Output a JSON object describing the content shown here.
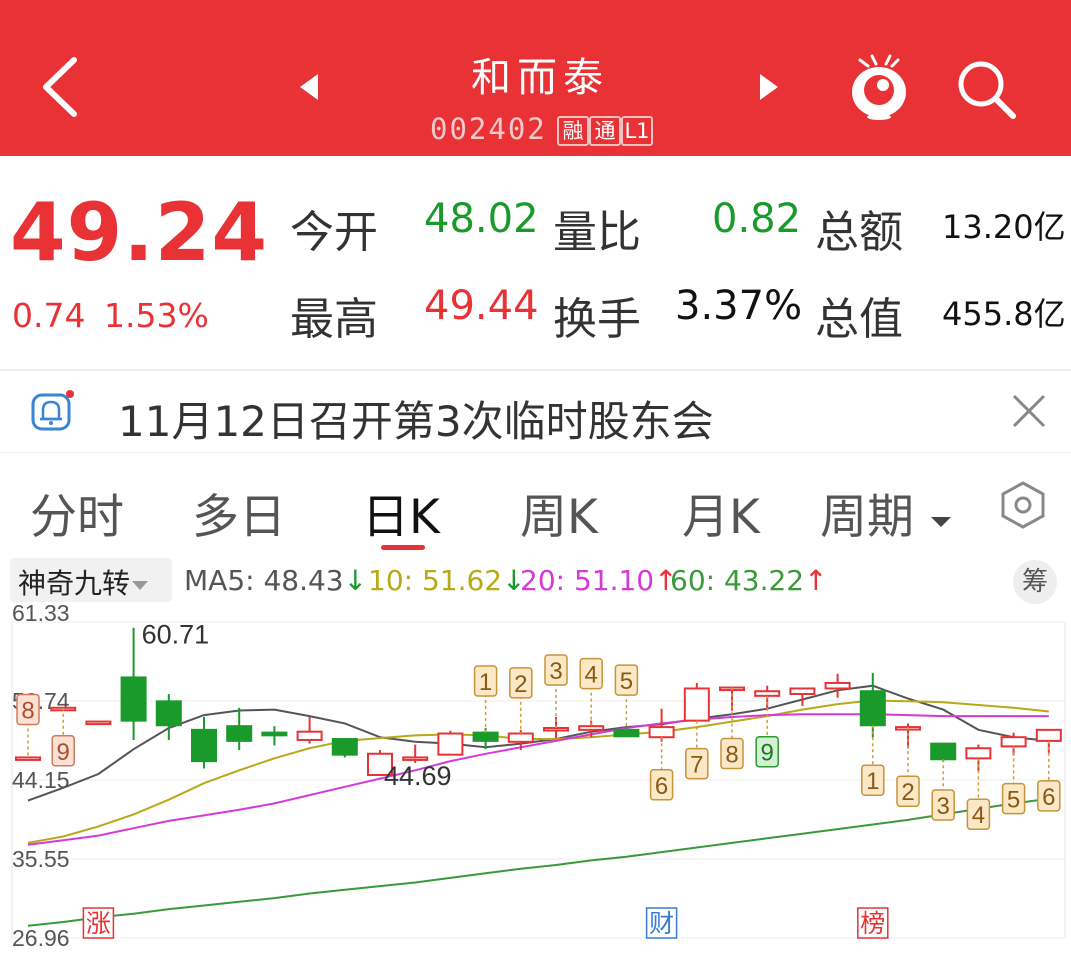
{
  "header": {
    "stock_name": "和而泰",
    "stock_code": "002402",
    "tags": [
      "融",
      "通",
      "L1"
    ],
    "bg_color": "#e83236",
    "icons": [
      "back-arrow-icon",
      "prev-triangle-icon",
      "next-triangle-icon",
      "mascot-icon",
      "search-icon"
    ]
  },
  "quote": {
    "price": "49.24",
    "change": "0.74",
    "change_pct": "1.53%",
    "open_label": "今开",
    "open": "48.02",
    "vol_ratio_label": "量比",
    "vol_ratio": "0.82",
    "amount_label": "总额",
    "amount": "13.20亿",
    "high_label": "最高",
    "high": "49.44",
    "turnover_label": "换手",
    "turnover": "3.37%",
    "mktcap_label": "总值",
    "mktcap": "455.8亿"
  },
  "notice": {
    "text": "11月12日召开第3次临时股东会",
    "icons": [
      "bell-icon",
      "close-icon"
    ]
  },
  "tabs": [
    {
      "label": "分时",
      "active": false
    },
    {
      "label": "多日",
      "active": false
    },
    {
      "label": "日K",
      "active": true
    },
    {
      "label": "周K",
      "active": false
    },
    {
      "label": "月K",
      "active": false
    },
    {
      "label": "周期",
      "active": false
    }
  ],
  "indicator": {
    "selected": "神奇九转",
    "ma5": "MA5: 48.43",
    "ma10": "10: 51.62",
    "ma20": "20: 51.10",
    "ma60": "60: 43.22",
    "chip_label": "筹",
    "colors": {
      "ma5": "#555555",
      "ma10": "#b8a91a",
      "ma20": "#d63ad6",
      "ma60": "#3a9a3a",
      "up": "#e83236",
      "down": "#1a9a2a"
    }
  },
  "chart_data": {
    "type": "candlestick",
    "y_ticks": [
      "61.33",
      "52.74",
      "44.15",
      "35.55",
      "26.96"
    ],
    "ylim": [
      26.96,
      61.33
    ],
    "max_label": "60.71",
    "min_label": "44.69",
    "candles": [
      {
        "o": 46.6,
        "h": 46.7,
        "l": 46.5,
        "c": 46.6
      },
      {
        "o": 52.0,
        "h": 52.0,
        "l": 52.0,
        "c": 52.0
      },
      {
        "o": 50.5,
        "h": 50.5,
        "l": 50.5,
        "c": 50.5
      },
      {
        "o": 55.3,
        "h": 60.71,
        "l": 48.5,
        "c": 50.6
      },
      {
        "o": 52.7,
        "h": 53.5,
        "l": 48.5,
        "c": 50.1
      },
      {
        "o": 49.6,
        "h": 51.0,
        "l": 45.4,
        "c": 46.2
      },
      {
        "o": 50.0,
        "h": 52.0,
        "l": 47.4,
        "c": 48.4
      },
      {
        "o": 49.3,
        "h": 50.0,
        "l": 47.9,
        "c": 49.0
      },
      {
        "o": 48.5,
        "h": 51.0,
        "l": 48.1,
        "c": 49.4
      },
      {
        "o": 48.6,
        "h": 48.7,
        "l": 46.6,
        "c": 46.9
      },
      {
        "o": 44.69,
        "h": 47.4,
        "l": 44.69,
        "c": 47.0
      },
      {
        "o": 46.6,
        "h": 48.0,
        "l": 46.0,
        "c": 46.6
      },
      {
        "o": 46.9,
        "h": 49.5,
        "l": 46.8,
        "c": 49.2
      },
      {
        "o": 49.3,
        "h": 49.8,
        "l": 47.5,
        "c": 48.4
      },
      {
        "o": 48.3,
        "h": 49.6,
        "l": 47.4,
        "c": 49.2
      },
      {
        "o": 49.8,
        "h": 51.0,
        "l": 48.7,
        "c": 49.8
      },
      {
        "o": 49.6,
        "h": 50.6,
        "l": 48.8,
        "c": 50.0
      },
      {
        "o": 49.6,
        "h": 49.9,
        "l": 48.8,
        "c": 48.9
      },
      {
        "o": 48.8,
        "h": 51.9,
        "l": 48.3,
        "c": 49.9
      },
      {
        "o": 50.6,
        "h": 54.7,
        "l": 50.6,
        "c": 54.1
      },
      {
        "o": 54.2,
        "h": 54.2,
        "l": 51.7,
        "c": 54.2
      },
      {
        "o": 53.3,
        "h": 54.4,
        "l": 51.9,
        "c": 53.8
      },
      {
        "o": 53.5,
        "h": 54.2,
        "l": 52.2,
        "c": 54.1
      },
      {
        "o": 54.1,
        "h": 55.7,
        "l": 53.1,
        "c": 54.7
      },
      {
        "o": 53.8,
        "h": 55.8,
        "l": 48.8,
        "c": 50.1
      },
      {
        "o": 49.9,
        "h": 50.3,
        "l": 47.6,
        "c": 49.9
      },
      {
        "o": 48.1,
        "h": 48.2,
        "l": 46.1,
        "c": 46.4
      },
      {
        "o": 46.5,
        "h": 48.0,
        "l": 45.1,
        "c": 47.6
      },
      {
        "o": 47.8,
        "h": 49.3,
        "l": 46.8,
        "c": 48.8
      },
      {
        "o": 48.4,
        "h": 49.4,
        "l": 47.1,
        "c": 49.6
      }
    ],
    "ma_series": [
      {
        "name": "MA5",
        "color": "#555555",
        "values": [
          41.9,
          43.3,
          44.8,
          47.5,
          49.8,
          51.2,
          51.7,
          51.8,
          51.1,
          50.3,
          48.8,
          48.3,
          48.1,
          47.7,
          48.1,
          48.6,
          49.4,
          49.9,
          50.2,
          50.8,
          51.3,
          51.9,
          52.9,
          53.9,
          54.4,
          53.0,
          51.8,
          49.6,
          48.8,
          48.4
        ]
      },
      {
        "name": "MA10",
        "color": "#b8a91a",
        "values": [
          37.3,
          38.0,
          39.1,
          40.4,
          42.0,
          43.8,
          45.2,
          46.5,
          47.6,
          48.4,
          48.7,
          49.0,
          49.1,
          49.0,
          48.6,
          48.6,
          48.8,
          49.1,
          49.4,
          49.9,
          50.5,
          51.1,
          51.8,
          52.4,
          52.8,
          52.7,
          52.6,
          52.3,
          52.0,
          51.6
        ]
      },
      {
        "name": "MA20",
        "color": "#d63ad6",
        "values": [
          37.1,
          37.6,
          38.1,
          38.9,
          39.7,
          40.3,
          40.9,
          41.6,
          42.5,
          43.4,
          44.3,
          45.2,
          46.2,
          47.0,
          47.7,
          48.4,
          49.1,
          49.8,
          50.3,
          50.7,
          51.0,
          51.2,
          51.3,
          51.3,
          51.3,
          51.2,
          51.1,
          51.1,
          51.1,
          51.1
        ]
      },
      {
        "name": "MA60",
        "color": "#3a9a3a",
        "values": [
          28.3,
          28.7,
          29.2,
          29.6,
          30.1,
          30.5,
          30.9,
          31.3,
          31.8,
          32.2,
          32.6,
          33.0,
          33.5,
          34.0,
          34.5,
          34.9,
          35.4,
          35.8,
          36.3,
          36.8,
          37.3,
          37.8,
          38.3,
          38.8,
          39.3,
          39.8,
          40.4,
          41.0,
          41.6,
          42.1
        ]
      }
    ],
    "nine_turn": [
      {
        "i": 0,
        "n": "8",
        "pos": "above",
        "style": "sell"
      },
      {
        "i": 1,
        "n": "9",
        "pos": "below",
        "style": "sell"
      },
      {
        "i": 13,
        "n": "1",
        "pos": "above",
        "style": "buy"
      },
      {
        "i": 14,
        "n": "2",
        "pos": "above",
        "style": "buy"
      },
      {
        "i": 15,
        "n": "3",
        "pos": "above",
        "style": "buy"
      },
      {
        "i": 16,
        "n": "4",
        "pos": "above",
        "style": "buy"
      },
      {
        "i": 17,
        "n": "5",
        "pos": "above",
        "style": "buy"
      },
      {
        "i": 18,
        "n": "6",
        "pos": "below",
        "style": "buy"
      },
      {
        "i": 19,
        "n": "7",
        "pos": "below",
        "style": "buy"
      },
      {
        "i": 20,
        "n": "8",
        "pos": "below",
        "style": "buy"
      },
      {
        "i": 21,
        "n": "9",
        "pos": "below",
        "style": "final"
      },
      {
        "i": 24,
        "n": "1",
        "pos": "below",
        "style": "buy"
      },
      {
        "i": 25,
        "n": "2",
        "pos": "below",
        "style": "buy"
      },
      {
        "i": 26,
        "n": "3",
        "pos": "below",
        "style": "buy"
      },
      {
        "i": 27,
        "n": "4",
        "pos": "below",
        "style": "buy"
      },
      {
        "i": 28,
        "n": "5",
        "pos": "below",
        "style": "buy"
      },
      {
        "i": 29,
        "n": "6",
        "pos": "below",
        "style": "buy"
      }
    ],
    "event_markers": [
      {
        "i": 2,
        "label": "涨",
        "color": "#e83236"
      },
      {
        "i": 18,
        "label": "财",
        "color": "#3a7bd5"
      },
      {
        "i": 24,
        "label": "榜",
        "color": "#e83236"
      }
    ]
  }
}
